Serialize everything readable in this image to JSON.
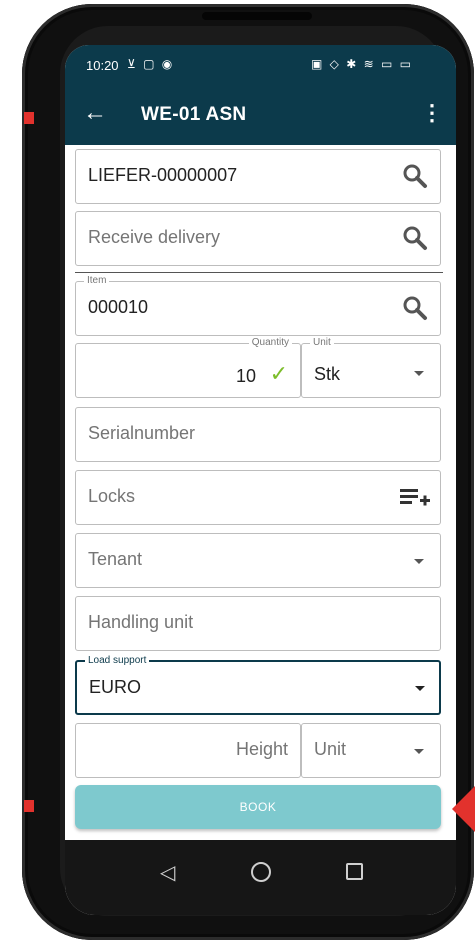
{
  "status_bar": {
    "time": "10:20",
    "left_icons": "⊻ ▢ ◉",
    "right_icons": "▣ ◇ ✱ ≋ ▭ ▭"
  },
  "app_bar": {
    "title": "WE-01 ASN",
    "back_icon": "←",
    "menu_icon": "⋮"
  },
  "form": {
    "supplier": {
      "value": "LIEFER-00000007"
    },
    "delivery": {
      "placeholder": "Receive delivery"
    },
    "item": {
      "label": "Item",
      "value": "000010"
    },
    "quantity": {
      "label": "Quantity",
      "value": "10"
    },
    "unit": {
      "label": "Unit",
      "value": "Stk"
    },
    "serialnumber": {
      "placeholder": "Serialnumber"
    },
    "locks": {
      "placeholder": "Locks"
    },
    "tenant": {
      "placeholder": "Tenant"
    },
    "handling_unit": {
      "placeholder": "Handling unit"
    },
    "load_support": {
      "label": "Load support",
      "value": "EURO"
    },
    "height": {
      "placeholder": "Height"
    },
    "height_unit": {
      "placeholder": "Unit"
    },
    "book_label": "BOOK"
  },
  "icons": {
    "check": "✓",
    "nav_back": "◁"
  },
  "colors": {
    "header": "#0c3a4b",
    "book_button": "#7ec9ce",
    "accent_red": "#e2322d",
    "check_green": "#7cbd2a"
  }
}
